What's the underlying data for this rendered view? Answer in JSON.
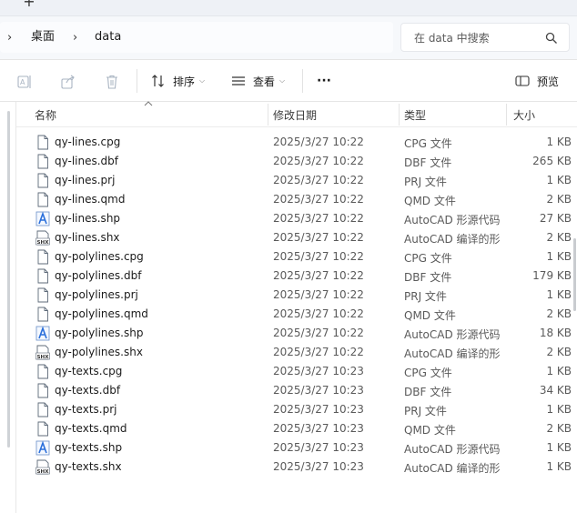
{
  "tabstrip": {
    "new_tab_glyph": "+"
  },
  "address": {
    "breadcrumb": [
      {
        "label": "桌面"
      },
      {
        "label": "data"
      }
    ],
    "search_placeholder": "在 data 中搜索"
  },
  "toolbar": {
    "sort_label": "排序",
    "view_label": "查看",
    "more_glyph": "···",
    "preview_label": "预览"
  },
  "columns": {
    "name": "名称",
    "modified": "修改日期",
    "type": "类型",
    "size": "大小"
  },
  "files": [
    {
      "name": "qy-lines.cpg",
      "date": "2025/3/27 10:22",
      "type": "CPG 文件",
      "size": "1 KB",
      "icon": "file-icon"
    },
    {
      "name": "qy-lines.dbf",
      "date": "2025/3/27 10:22",
      "type": "DBF 文件",
      "size": "265 KB",
      "icon": "file-icon"
    },
    {
      "name": "qy-lines.prj",
      "date": "2025/3/27 10:22",
      "type": "PRJ 文件",
      "size": "1 KB",
      "icon": "file-icon"
    },
    {
      "name": "qy-lines.qmd",
      "date": "2025/3/27 10:22",
      "type": "QMD 文件",
      "size": "2 KB",
      "icon": "file-icon"
    },
    {
      "name": "qy-lines.shp",
      "date": "2025/3/27 10:22",
      "type": "AutoCAD 形源代码",
      "size": "27 KB",
      "icon": "autocad-shp-icon"
    },
    {
      "name": "qy-lines.shx",
      "date": "2025/3/27 10:22",
      "type": "AutoCAD 编译的形",
      "size": "2 KB",
      "icon": "shx-icon"
    },
    {
      "name": "qy-polylines.cpg",
      "date": "2025/3/27 10:22",
      "type": "CPG 文件",
      "size": "1 KB",
      "icon": "file-icon"
    },
    {
      "name": "qy-polylines.dbf",
      "date": "2025/3/27 10:22",
      "type": "DBF 文件",
      "size": "179 KB",
      "icon": "file-icon"
    },
    {
      "name": "qy-polylines.prj",
      "date": "2025/3/27 10:22",
      "type": "PRJ 文件",
      "size": "1 KB",
      "icon": "file-icon"
    },
    {
      "name": "qy-polylines.qmd",
      "date": "2025/3/27 10:22",
      "type": "QMD 文件",
      "size": "2 KB",
      "icon": "file-icon"
    },
    {
      "name": "qy-polylines.shp",
      "date": "2025/3/27 10:22",
      "type": "AutoCAD 形源代码",
      "size": "18 KB",
      "icon": "autocad-shp-icon"
    },
    {
      "name": "qy-polylines.shx",
      "date": "2025/3/27 10:22",
      "type": "AutoCAD 编译的形",
      "size": "2 KB",
      "icon": "shx-icon"
    },
    {
      "name": "qy-texts.cpg",
      "date": "2025/3/27 10:23",
      "type": "CPG 文件",
      "size": "1 KB",
      "icon": "file-icon"
    },
    {
      "name": "qy-texts.dbf",
      "date": "2025/3/27 10:23",
      "type": "DBF 文件",
      "size": "34 KB",
      "icon": "file-icon"
    },
    {
      "name": "qy-texts.prj",
      "date": "2025/3/27 10:23",
      "type": "PRJ 文件",
      "size": "1 KB",
      "icon": "file-icon"
    },
    {
      "name": "qy-texts.qmd",
      "date": "2025/3/27 10:23",
      "type": "QMD 文件",
      "size": "2 KB",
      "icon": "file-icon"
    },
    {
      "name": "qy-texts.shp",
      "date": "2025/3/27 10:23",
      "type": "AutoCAD 形源代码",
      "size": "1 KB",
      "icon": "autocad-shp-icon"
    },
    {
      "name": "qy-texts.shx",
      "date": "2025/3/27 10:23",
      "type": "AutoCAD 编译的形",
      "size": "1 KB",
      "icon": "shx-icon"
    }
  ],
  "colors": {
    "accent": "#0067c0",
    "autocad_blue": "#2a6fdb",
    "text_secondary": "#5a5a5a"
  }
}
